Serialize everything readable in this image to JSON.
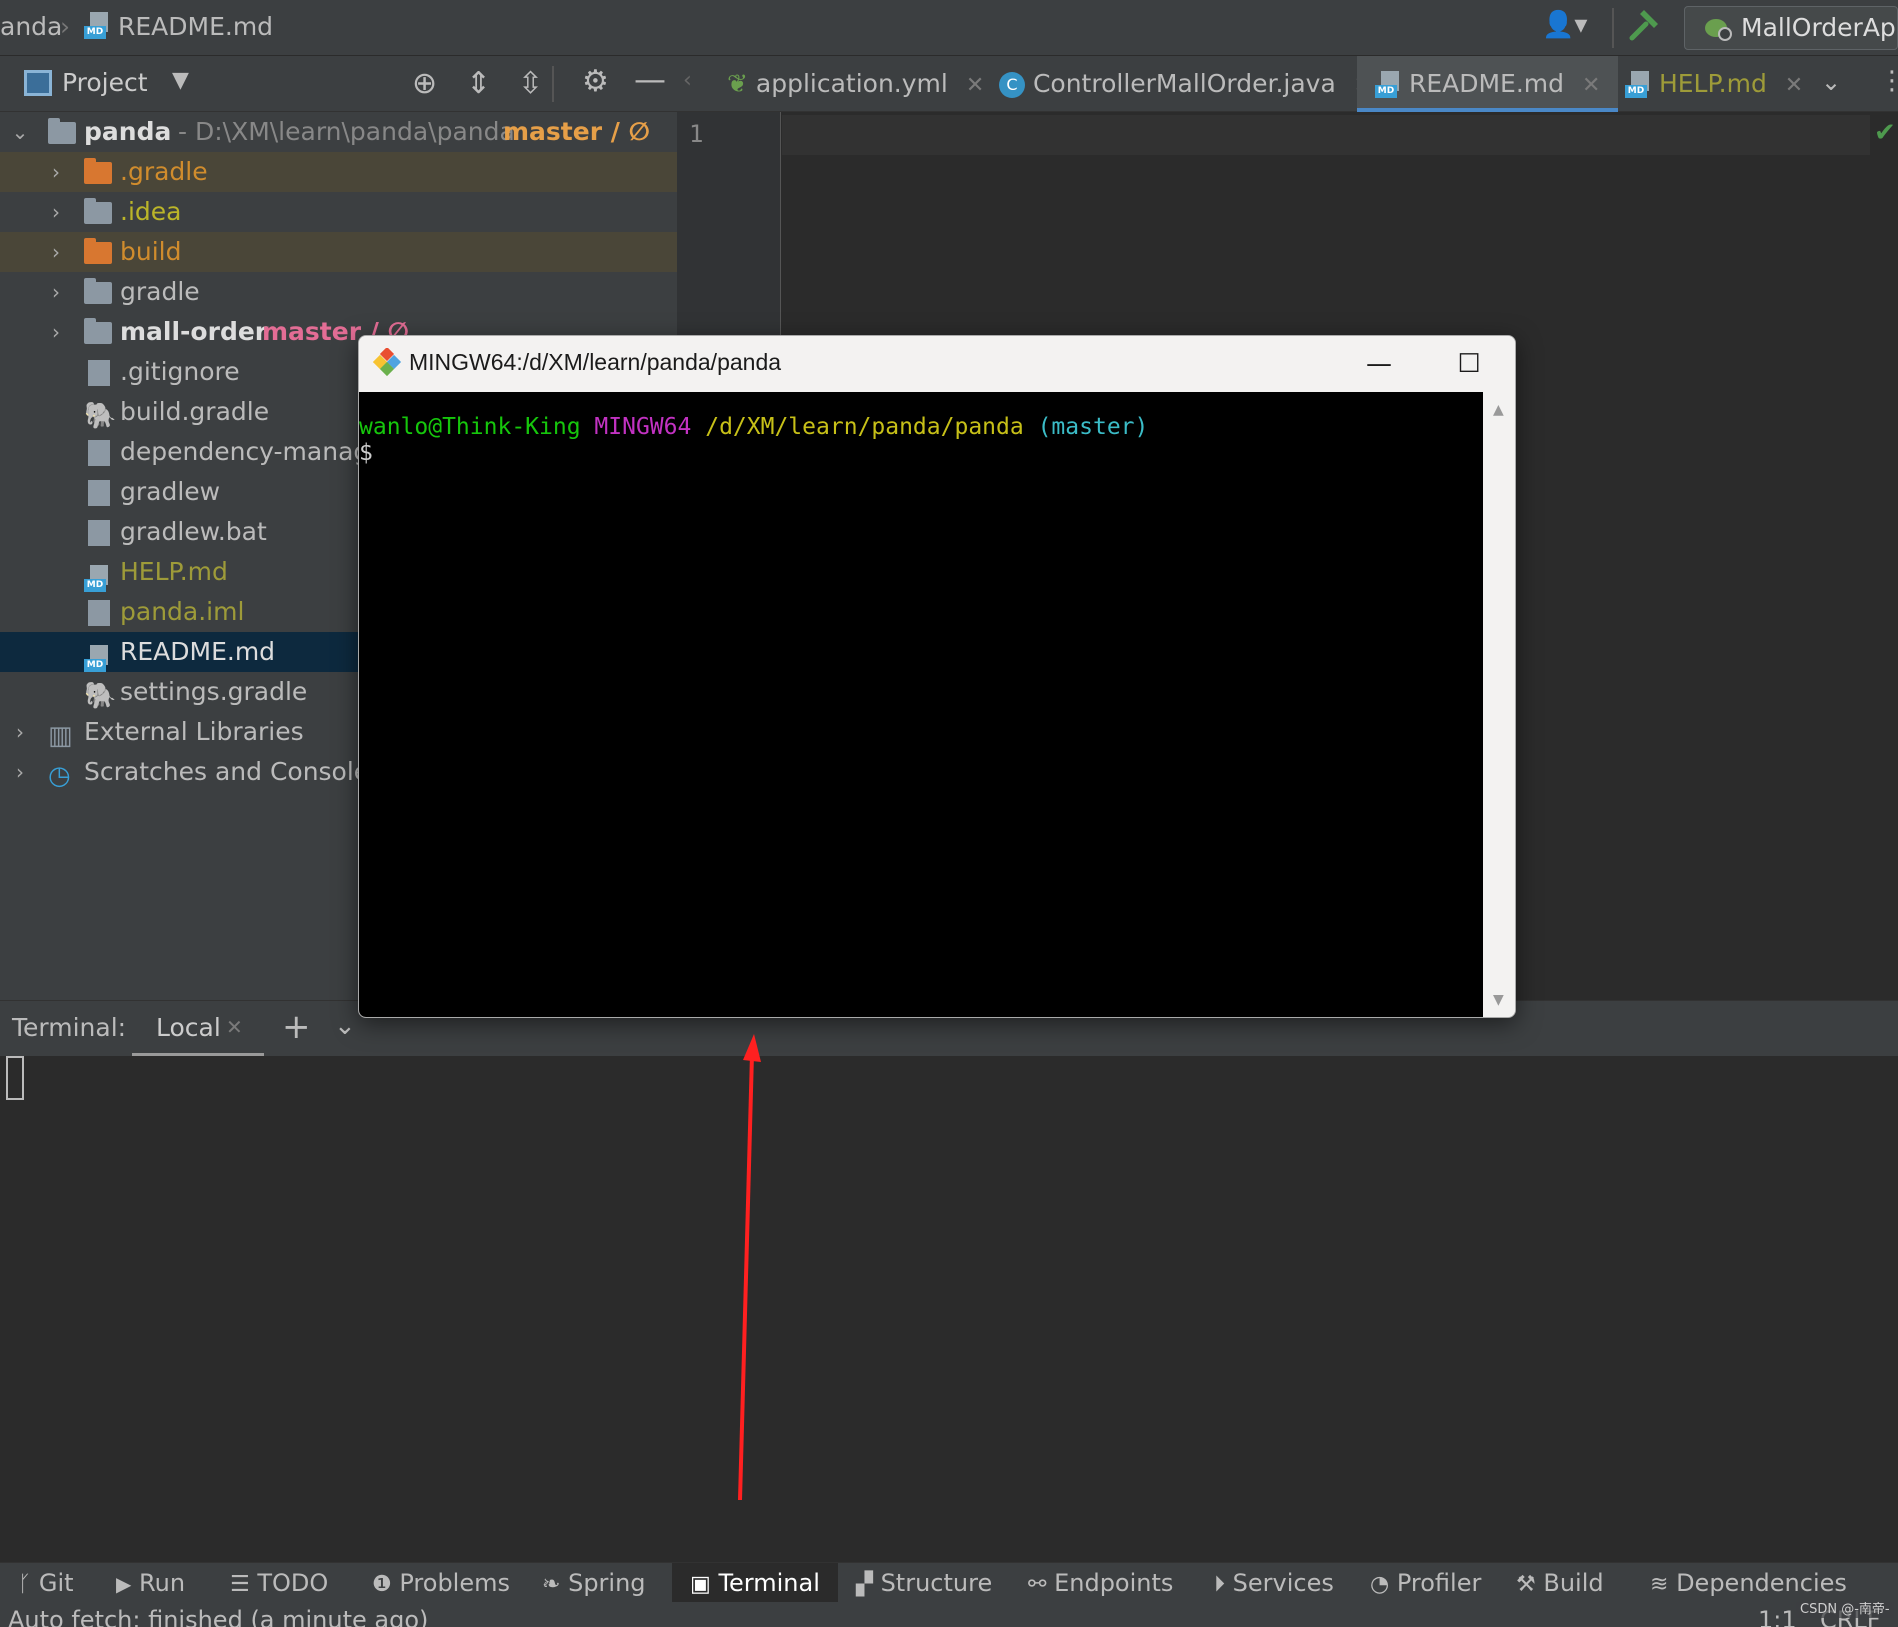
{
  "breadcrumb": {
    "project": "anda",
    "file": "README.md"
  },
  "run_config": {
    "name": "MallOrderApp"
  },
  "project_panel": {
    "title": "Project",
    "root": {
      "name": "panda",
      "path": "- D:\\XM\\learn\\panda\\panda",
      "branch": "master / ∅"
    },
    "items": [
      {
        "name": ".gradle"
      },
      {
        "name": ".idea"
      },
      {
        "name": "build"
      },
      {
        "name": "gradle"
      },
      {
        "name": "mall-order",
        "branch": "master / ∅"
      },
      {
        "name": ".gitignore"
      },
      {
        "name": "build.gradle"
      },
      {
        "name": "dependency-management.gradle"
      },
      {
        "name": "gradlew"
      },
      {
        "name": "gradlew.bat"
      },
      {
        "name": "HELP.md"
      },
      {
        "name": "panda.iml"
      },
      {
        "name": "README.md"
      },
      {
        "name": "settings.gradle"
      },
      {
        "name": "External Libraries"
      },
      {
        "name": "Scratches and Consoles"
      }
    ]
  },
  "editor": {
    "tabs": [
      {
        "label": "application.yml"
      },
      {
        "label": "ControllerMallOrder.java"
      },
      {
        "label": "README.md"
      },
      {
        "label": "HELP.md"
      }
    ],
    "line_number": "1"
  },
  "mingw_window": {
    "title": "MINGW64:/d/XM/learn/panda/panda",
    "prompt_user": "wanlo@Think-King",
    "prompt_env": "MINGW64",
    "prompt_path": "/d/XM/learn/panda/panda",
    "prompt_branch": "(master)",
    "prompt_symbol": "$"
  },
  "terminal": {
    "title": "Terminal:",
    "tab": "Local"
  },
  "bottom_tools": [
    {
      "label": "Git"
    },
    {
      "label": "Run"
    },
    {
      "label": "TODO"
    },
    {
      "label": "Problems"
    },
    {
      "label": "Spring"
    },
    {
      "label": "Terminal"
    },
    {
      "label": "Structure"
    },
    {
      "label": "Endpoints"
    },
    {
      "label": "Services"
    },
    {
      "label": "Profiler"
    },
    {
      "label": "Build"
    },
    {
      "label": "Dependencies"
    }
  ],
  "status": {
    "message": "Auto fetch: finished (a minute ago)",
    "position": "1:1",
    "line_sep": "CRLF",
    "watermark": "CSDN @-南帝-"
  },
  "colors": {
    "prompt_user": "#16c60c",
    "prompt_env": "#c232c2",
    "prompt_path": "#c7c018",
    "prompt_branch": "#3bbcc7",
    "arrow": "#ff2020"
  }
}
